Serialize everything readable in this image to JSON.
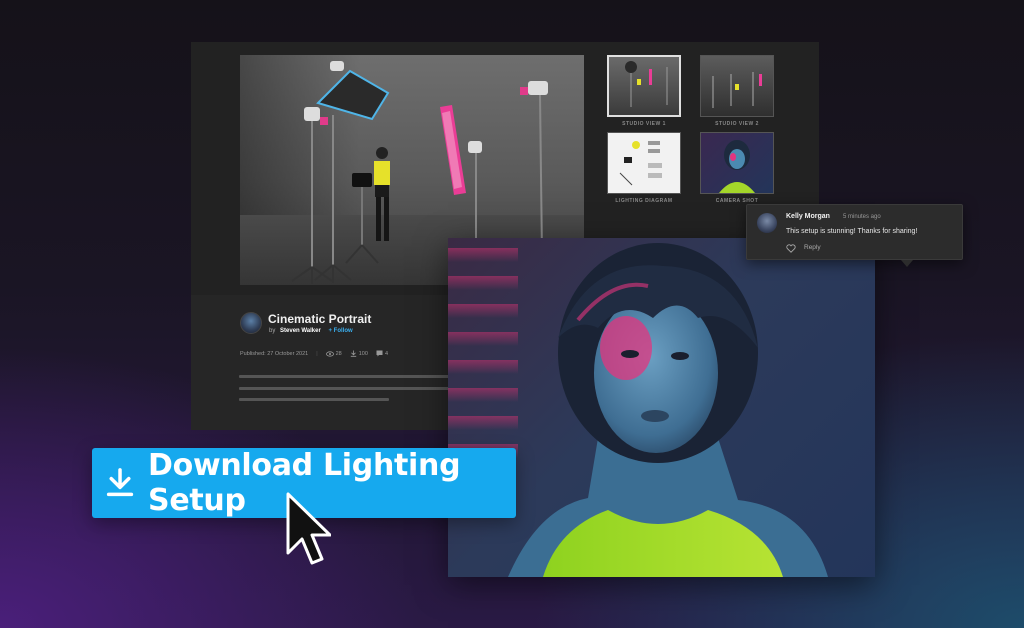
{
  "gallery": {
    "thumbnails": [
      {
        "caption": "STUDIO VIEW 1",
        "active": true
      },
      {
        "caption": "STUDIO VIEW 2",
        "active": false
      },
      {
        "caption": "LIGHTING DIAGRAM",
        "active": false
      },
      {
        "caption": "CAMERA SHOT",
        "active": false
      }
    ]
  },
  "post": {
    "title": "Cinematic Portrait",
    "by_prefix": "by",
    "author": "Steven Walker",
    "follow_label": "+ Follow",
    "published": "Published: 27 October 2021",
    "separator": "|",
    "views": "28",
    "downloads": "100",
    "comments": "4"
  },
  "comment": {
    "name": "Kelly Morgan",
    "time": "5 minutes ago",
    "text": "This setup is stunning! Thanks for sharing!",
    "reply_label": "Reply"
  },
  "cta": {
    "label": "Download Lighting Setup",
    "icon": "download-icon",
    "color": "#16a9ee"
  },
  "icons": {
    "views": "eye-icon",
    "downloads": "download-icon",
    "comments": "comment-icon",
    "like": "heart-icon",
    "pointer": "mouse-pointer-icon"
  }
}
